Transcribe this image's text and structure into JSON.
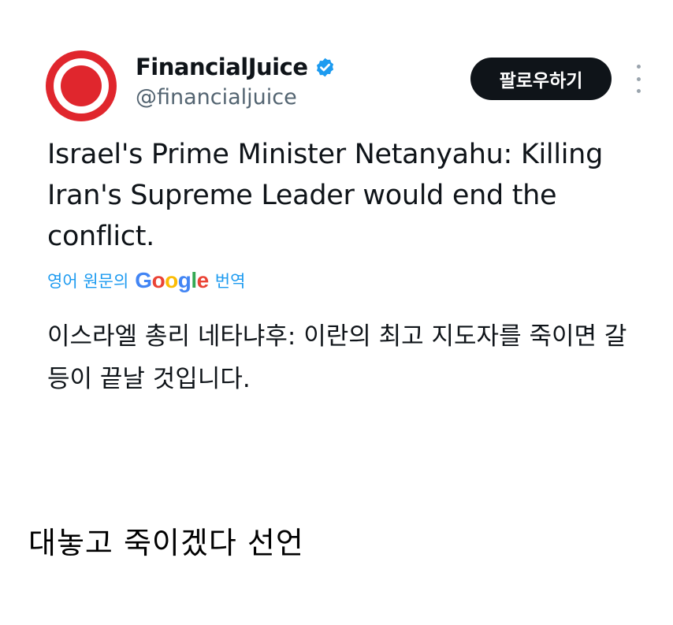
{
  "tweet": {
    "author": {
      "display_name": "FinancialJuice",
      "handle": "@financialjuice",
      "verified": true
    },
    "follow_label": "팔로우하기",
    "text": "Israel's Prime Minister Netanyahu: Killing Iran's Supreme Leader would end the conflict.",
    "translate": {
      "prefix": "영어 원문의",
      "brand": "Google",
      "suffix": "번역"
    },
    "translated_text": "이스라엘 총리 네타냐후: 이란의 최고 지도자를 죽이면 갈등이 끝날 것입니다."
  },
  "caption": "대놓고 죽이겠다 선언",
  "colors": {
    "accent_blue": "#1d9bf0",
    "avatar_red": "#e0262d",
    "follow_button_bg": "#0f1419",
    "handle_gray": "#536471"
  },
  "icons": {
    "verified": "verified-badge-icon",
    "more": "more-dots-vertical-icon",
    "avatar": "financialjuice-logo"
  }
}
